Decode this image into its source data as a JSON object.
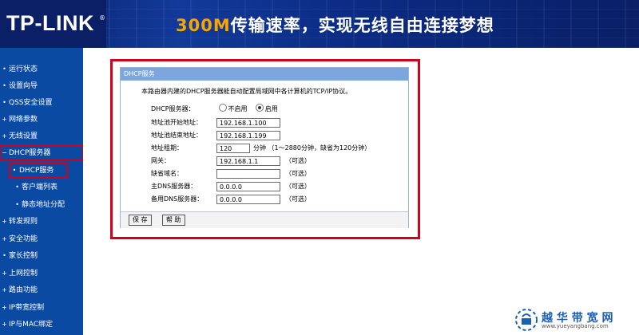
{
  "header": {
    "logo": "TP-LINK",
    "registered": "®",
    "slogan_speed": "300M",
    "slogan_rest": "传输速率，实现无线自由连接梦想"
  },
  "sidebar": {
    "items": [
      {
        "label": "运行状态",
        "bullet": "•"
      },
      {
        "label": "设置向导",
        "bullet": "•"
      },
      {
        "label": "QSS安全设置",
        "bullet": "•"
      },
      {
        "label": "网络参数",
        "bullet": "+"
      },
      {
        "label": "无线设置",
        "bullet": "+"
      },
      {
        "label": "DHCP服务器",
        "bullet": "−"
      },
      {
        "label": "DHCP服务",
        "bullet": "•"
      },
      {
        "label": "客户端列表",
        "bullet": "•"
      },
      {
        "label": "静态地址分配",
        "bullet": "•"
      },
      {
        "label": "转发规则",
        "bullet": "+"
      },
      {
        "label": "安全功能",
        "bullet": "+"
      },
      {
        "label": "家长控制",
        "bullet": "•"
      },
      {
        "label": "上网控制",
        "bullet": "+"
      },
      {
        "label": "路由功能",
        "bullet": "+"
      },
      {
        "label": "IP带宽控制",
        "bullet": "+"
      },
      {
        "label": "IP与MAC绑定",
        "bullet": "+"
      }
    ]
  },
  "panel": {
    "title": "DHCP服务",
    "description": "本路由器内建的DHCP服务器能自动配置局域网中各计算机的TCP/IP协议。",
    "dhcp_server_label": "DHCP服务器：",
    "option_disable": "不启用",
    "option_enable": "启用",
    "start_ip_label": "地址池开始地址：",
    "start_ip": "192.168.1.100",
    "end_ip_label": "地址池结束地址：",
    "end_ip": "192.168.1.199",
    "lease_label": "地址租期：",
    "lease_value": "120",
    "lease_hint": "分钟 （1～2880分钟，缺省为120分钟）",
    "gateway_label": "网关：",
    "gateway": "192.168.1.1",
    "optional": "（可选）",
    "domain_label": "缺省域名：",
    "domain": "",
    "dns1_label": "主DNS服务器：",
    "dns1": "0.0.0.0",
    "dns2_label": "备用DNS服务器：",
    "dns2": "0.0.0.0",
    "save": "保 存",
    "help": "帮 助"
  },
  "watermark": {
    "brand": "越 华 带 宽 网",
    "url": "www.yueyangbang.com"
  }
}
